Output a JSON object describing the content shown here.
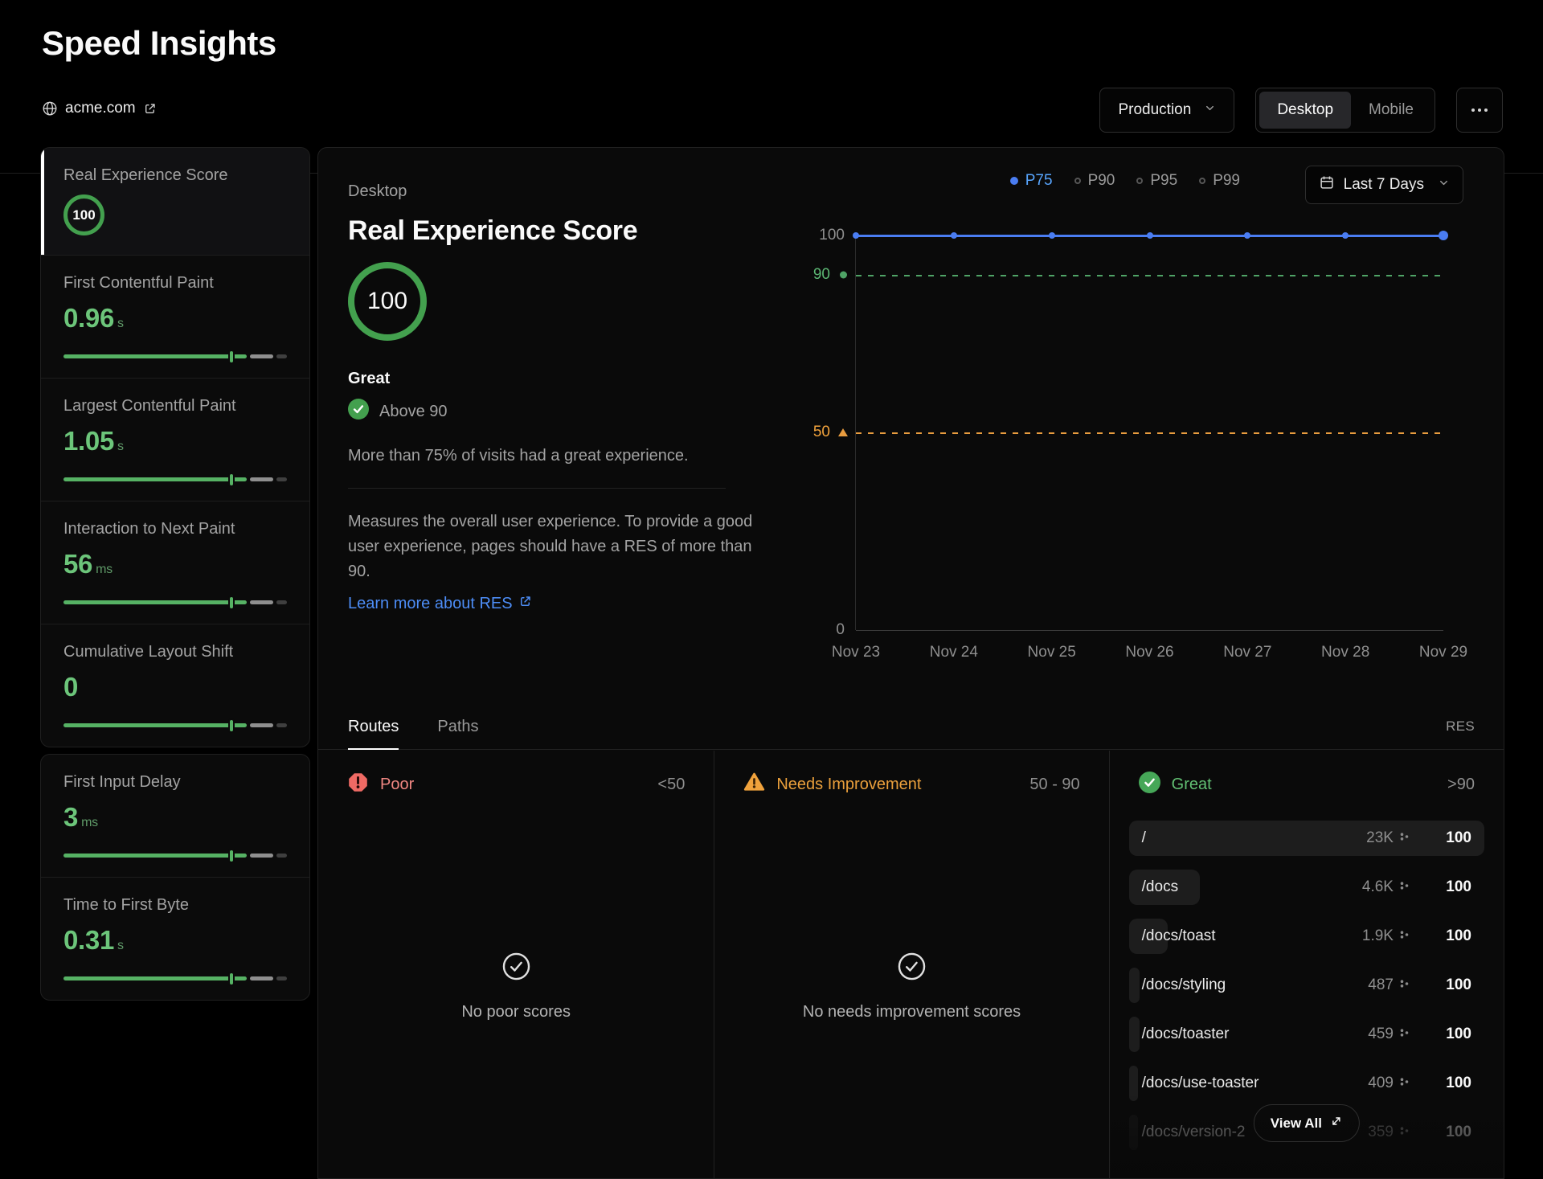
{
  "header": {
    "title": "Speed Insights",
    "site": "acme.com",
    "environment": "Production",
    "devices": [
      "Desktop",
      "Mobile"
    ],
    "active_device": "Desktop"
  },
  "sidebar": {
    "metrics": [
      {
        "label": "Real Experience Score",
        "value": "100",
        "unit": ""
      },
      {
        "label": "First Contentful Paint",
        "value": "0.96",
        "unit": "s"
      },
      {
        "label": "Largest Contentful Paint",
        "value": "1.05",
        "unit": "s"
      },
      {
        "label": "Interaction to Next Paint",
        "value": "56",
        "unit": "ms"
      },
      {
        "label": "Cumulative Layout Shift",
        "value": "0",
        "unit": ""
      }
    ],
    "metrics2": [
      {
        "label": "First Input Delay",
        "value": "3",
        "unit": "ms"
      },
      {
        "label": "Time to First Byte",
        "value": "0.31",
        "unit": "s"
      }
    ]
  },
  "main": {
    "device_label": "Desktop",
    "title": "Real Experience Score",
    "score": "100",
    "rating": "Great",
    "threshold": "Above 90",
    "summary": "More than 75% of visits had a great experience.",
    "description": "Measures the overall user experience. To provide a good user experience, pages should have a RES of more than 90.",
    "learn_more": "Learn more about RES"
  },
  "chart": {
    "period": "Last 7 Days"
  },
  "chart_data": {
    "type": "line",
    "x": [
      "Nov 23",
      "Nov 24",
      "Nov 25",
      "Nov 26",
      "Nov 27",
      "Nov 28",
      "Nov 29"
    ],
    "series": [
      {
        "name": "P75",
        "values": [
          100,
          100,
          100,
          100,
          100,
          100,
          100
        ],
        "color": "#4a7df2"
      }
    ],
    "legend": [
      "P75",
      "P90",
      "P95",
      "P99"
    ],
    "legend_active": "P75",
    "legend_position": "top-right",
    "yticks": [
      "100",
      "90",
      "50",
      "0"
    ],
    "ylim": [
      0,
      100
    ],
    "grid": false,
    "reference_lines": [
      {
        "value": 90,
        "color": "#4fa366",
        "style": "dashed"
      },
      {
        "value": 50,
        "color": "#e89c3f",
        "style": "dashed"
      }
    ]
  },
  "tabs": {
    "routes": "Routes",
    "paths": "Paths",
    "res": "RES"
  },
  "columns": {
    "poor": {
      "label": "Poor",
      "range": "<50",
      "empty": "No poor scores"
    },
    "needs_improvement": {
      "label": "Needs Improvement",
      "range": "50 - 90",
      "empty": "No needs improvement scores"
    },
    "great": {
      "label": "Great",
      "range": ">90",
      "view_all": "View All",
      "routes": [
        {
          "path": "/",
          "visitors": "23K",
          "score": "100",
          "bar_pct": 100
        },
        {
          "path": "/docs",
          "visitors": "4.6K",
          "score": "100",
          "bar_pct": 20
        },
        {
          "path": "/docs/toast",
          "visitors": "1.9K",
          "score": "100",
          "bar_pct": 11
        },
        {
          "path": "/docs/styling",
          "visitors": "487",
          "score": "100",
          "bar_pct": 3
        },
        {
          "path": "/docs/toaster",
          "visitors": "459",
          "score": "100",
          "bar_pct": 3
        },
        {
          "path": "/docs/use-toaster",
          "visitors": "409",
          "score": "100",
          "bar_pct": 2.6
        },
        {
          "path": "/docs/version-2",
          "visitors": "359",
          "score": "100",
          "bar_pct": 2.3
        }
      ]
    }
  },
  "colors": {
    "green": "#4fa85c",
    "green_text": "#6cc57a",
    "blue_line": "#4a7df2",
    "blue_link": "#4d8df6",
    "orange": "#e89c3f",
    "red": "#ef6a64"
  }
}
